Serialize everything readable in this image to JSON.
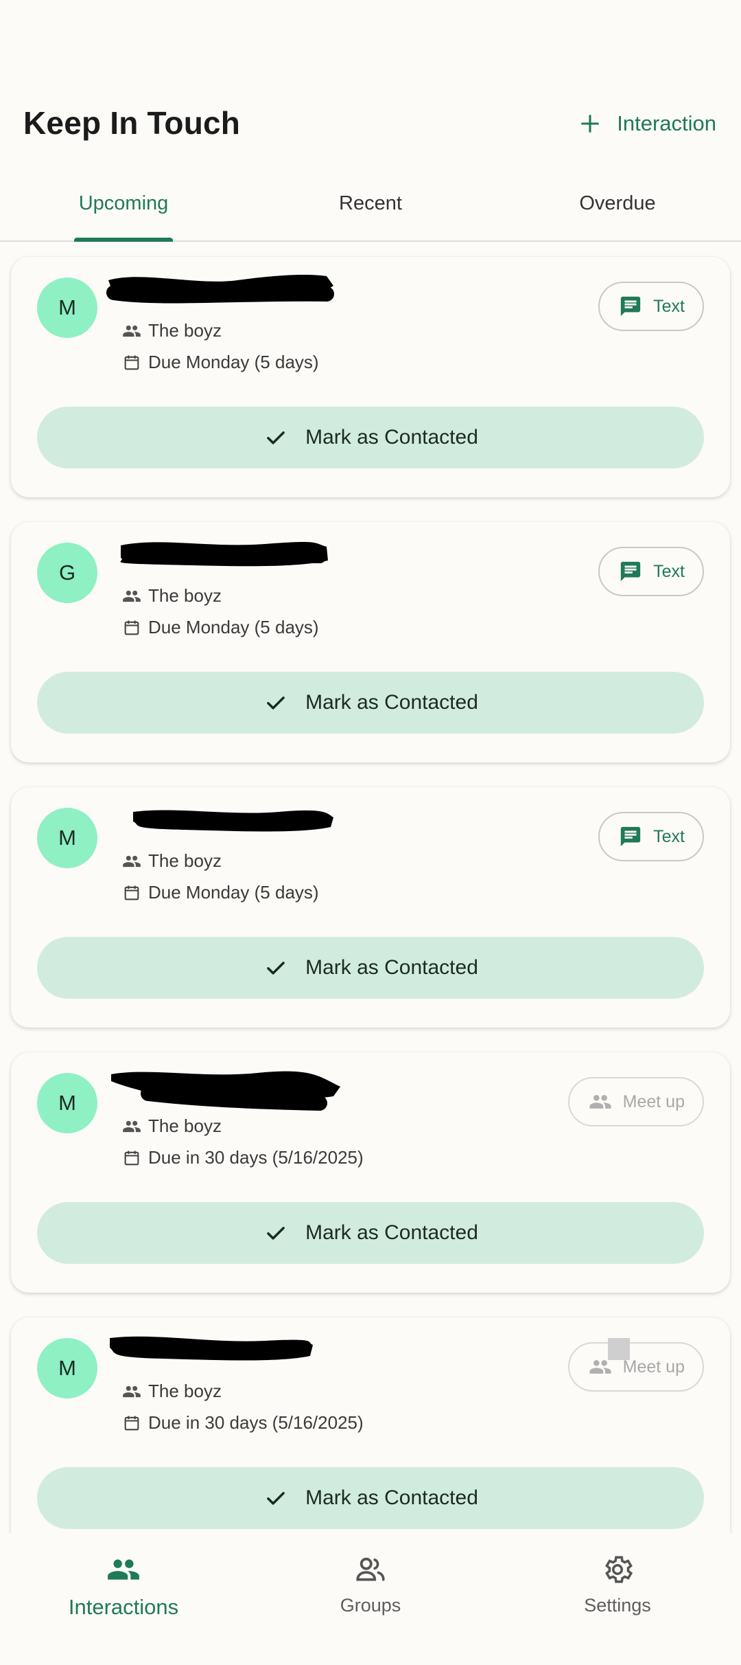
{
  "header": {
    "title": "Keep In Touch",
    "add_label": "Interaction"
  },
  "tabs": [
    {
      "label": "Upcoming",
      "active": true
    },
    {
      "label": "Recent",
      "active": false
    },
    {
      "label": "Overdue",
      "active": false
    }
  ],
  "cards": [
    {
      "initial": "M",
      "group": "The boyz",
      "due": "Due Monday (5 days)",
      "action": "Text",
      "action_enabled": true,
      "mark_label": "Mark as Contacted"
    },
    {
      "initial": "G",
      "group": "The boyz",
      "due": "Due Monday (5 days)",
      "action": "Text",
      "action_enabled": true,
      "mark_label": "Mark as Contacted"
    },
    {
      "initial": "M",
      "group": "The boyz",
      "due": "Due Monday (5 days)",
      "action": "Text",
      "action_enabled": true,
      "mark_label": "Mark as Contacted"
    },
    {
      "initial": "M",
      "group": "The boyz",
      "due": "Due in 30 days (5/16/2025)",
      "action": "Meet up",
      "action_enabled": false,
      "mark_label": "Mark as Contacted"
    },
    {
      "initial": "M",
      "group": "The boyz",
      "due": "Due in 30 days (5/16/2025)",
      "action": "Meet up",
      "action_enabled": false,
      "mark_label": "Mark as Contacted"
    }
  ],
  "nav": [
    {
      "label": "Interactions",
      "icon": "people-icon",
      "active": true
    },
    {
      "label": "Groups",
      "icon": "groups-icon",
      "active": false
    },
    {
      "label": "Settings",
      "icon": "gear-icon",
      "active": false
    }
  ],
  "colors": {
    "accent": "#1f7a57",
    "avatar_bg": "#8ef0c3",
    "mark_bg": "#d2ebdf",
    "background": "#fcfbf8"
  }
}
